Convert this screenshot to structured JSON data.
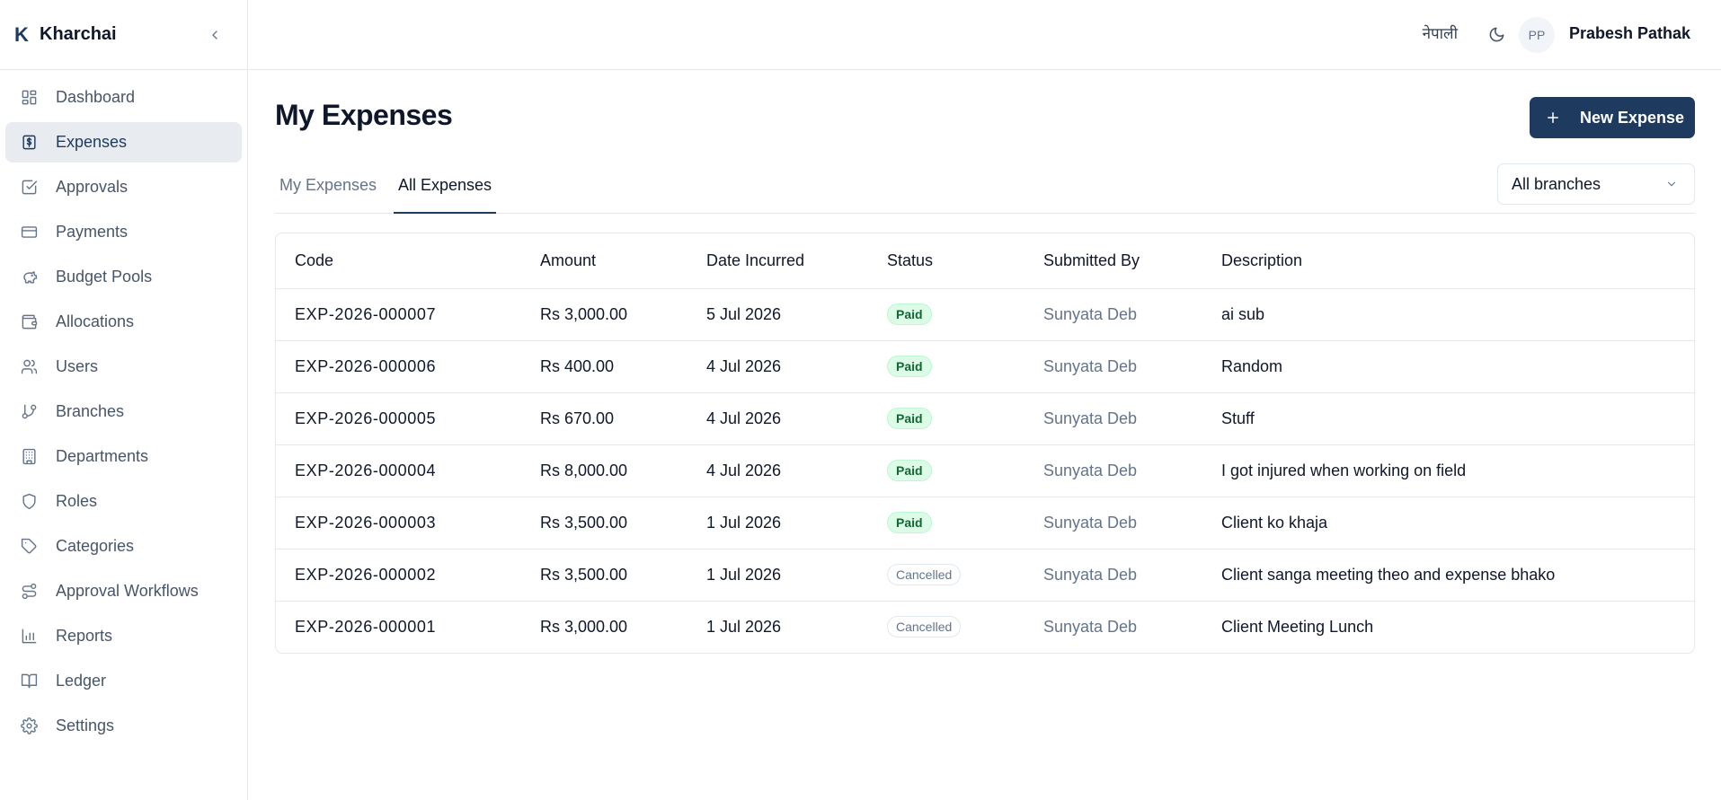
{
  "app": {
    "logo_letter": "K",
    "name": "Kharchai"
  },
  "sidebar": {
    "items": [
      {
        "label": "Dashboard",
        "icon": "dashboard-icon",
        "active": false
      },
      {
        "label": "Expenses",
        "icon": "receipt-icon",
        "active": true
      },
      {
        "label": "Approvals",
        "icon": "check-square-icon",
        "active": false
      },
      {
        "label": "Payments",
        "icon": "credit-card-icon",
        "active": false
      },
      {
        "label": "Budget Pools",
        "icon": "piggy-bank-icon",
        "active": false
      },
      {
        "label": "Allocations",
        "icon": "wallet-icon",
        "active": false
      },
      {
        "label": "Users",
        "icon": "users-icon",
        "active": false
      },
      {
        "label": "Branches",
        "icon": "git-branch-icon",
        "active": false
      },
      {
        "label": "Departments",
        "icon": "building-icon",
        "active": false
      },
      {
        "label": "Roles",
        "icon": "shield-icon",
        "active": false
      },
      {
        "label": "Categories",
        "icon": "tag-icon",
        "active": false
      },
      {
        "label": "Approval Workflows",
        "icon": "workflow-icon",
        "active": false
      },
      {
        "label": "Reports",
        "icon": "bar-chart-icon",
        "active": false
      },
      {
        "label": "Ledger",
        "icon": "book-icon",
        "active": false
      },
      {
        "label": "Settings",
        "icon": "gear-icon",
        "active": false
      }
    ]
  },
  "header": {
    "language": "नेपाली",
    "user_initials": "PP",
    "user_name": "Prabesh Pathak"
  },
  "page": {
    "title": "My Expenses",
    "new_button": "New Expense",
    "tabs": [
      {
        "label": "My Expenses",
        "active": false
      },
      {
        "label": "All Expenses",
        "active": true
      }
    ],
    "branch_filter": "All branches"
  },
  "table": {
    "columns": [
      "Code",
      "Amount",
      "Date Incurred",
      "Status",
      "Submitted By",
      "Description"
    ],
    "rows": [
      {
        "code": "EXP-2026-000007",
        "amount": "Rs 3,000.00",
        "date": "5 Jul 2026",
        "status": "Paid",
        "submitted_by": "Sunyata Deb",
        "description": "ai sub"
      },
      {
        "code": "EXP-2026-000006",
        "amount": "Rs 400.00",
        "date": "4 Jul 2026",
        "status": "Paid",
        "submitted_by": "Sunyata Deb",
        "description": "Random"
      },
      {
        "code": "EXP-2026-000005",
        "amount": "Rs 670.00",
        "date": "4 Jul 2026",
        "status": "Paid",
        "submitted_by": "Sunyata Deb",
        "description": "Stuff"
      },
      {
        "code": "EXP-2026-000004",
        "amount": "Rs 8,000.00",
        "date": "4 Jul 2026",
        "status": "Paid",
        "submitted_by": "Sunyata Deb",
        "description": "I got injured when working on field"
      },
      {
        "code": "EXP-2026-000003",
        "amount": "Rs 3,500.00",
        "date": "1 Jul 2026",
        "status": "Paid",
        "submitted_by": "Sunyata Deb",
        "description": "Client ko khaja"
      },
      {
        "code": "EXP-2026-000002",
        "amount": "Rs 3,500.00",
        "date": "1 Jul 2026",
        "status": "Cancelled",
        "submitted_by": "Sunyata Deb",
        "description": "Client sanga meeting theo and expense bhako"
      },
      {
        "code": "EXP-2026-000001",
        "amount": "Rs 3,000.00",
        "date": "1 Jul 2026",
        "status": "Cancelled",
        "submitted_by": "Sunyata Deb",
        "description": "Client Meeting Lunch"
      }
    ]
  },
  "colors": {
    "primary": "#1e3a5f",
    "paid_bg": "#dcfce7",
    "paid_text": "#166534",
    "border": "#e5e7eb"
  }
}
